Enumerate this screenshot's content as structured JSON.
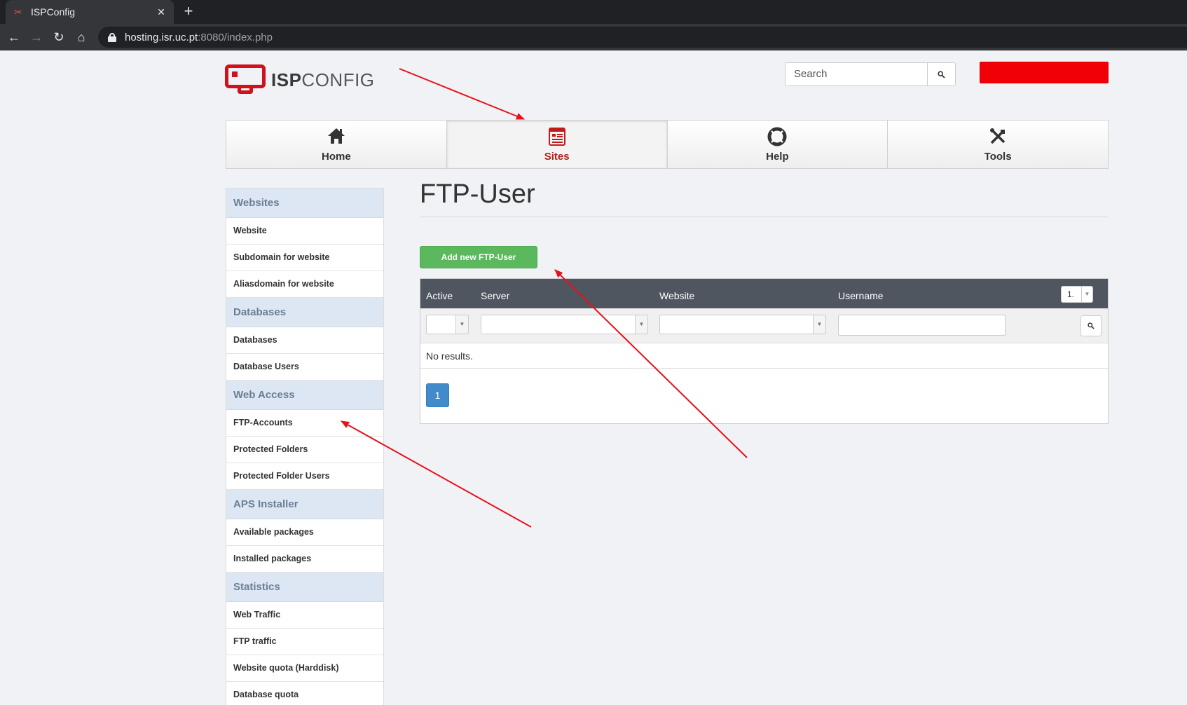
{
  "browser": {
    "tab_title": "ISPConfig",
    "tab_close": "✕",
    "new_tab": "+",
    "url_host": "hosting.isr.uc.pt",
    "url_rest": ":8080/index.php"
  },
  "header": {
    "logo_bold": "ISP",
    "logo_rest": "CONFIG",
    "search_placeholder": "Search",
    "user_box_color": "#f20008"
  },
  "mainnav": [
    {
      "label": "Home",
      "icon": "home-icon",
      "active": false
    },
    {
      "label": "Sites",
      "icon": "sites-icon",
      "active": true
    },
    {
      "label": "Help",
      "icon": "lifebuoy-icon",
      "active": false
    },
    {
      "label": "Tools",
      "icon": "tools-icon",
      "active": false
    }
  ],
  "sidebar": {
    "sections": [
      {
        "title": "Websites",
        "items": [
          "Website",
          "Subdomain for website",
          "Aliasdomain for website"
        ]
      },
      {
        "title": "Databases",
        "items": [
          "Databases",
          "Database Users"
        ]
      },
      {
        "title": "Web Access",
        "items": [
          "FTP-Accounts",
          "Protected Folders",
          "Protected Folder Users"
        ]
      },
      {
        "title": "APS Installer",
        "items": [
          "Available packages",
          "Installed packages"
        ]
      },
      {
        "title": "Statistics",
        "items": [
          "Web Traffic",
          "FTP traffic",
          "Website quota (Harddisk)",
          "Database quota"
        ]
      }
    ]
  },
  "main": {
    "title": "FTP-User",
    "add_button": "Add new FTP-User",
    "columns": [
      "Active",
      "Server",
      "Website",
      "Username"
    ],
    "per_page": "1.",
    "no_results": "No results.",
    "page": "1"
  },
  "colors": {
    "accent_red": "#c11a1a",
    "success_green": "#5cb85c",
    "primary_blue": "#428bca",
    "table_header": "#4f5660",
    "annotation_arrow": "#e8101a"
  }
}
